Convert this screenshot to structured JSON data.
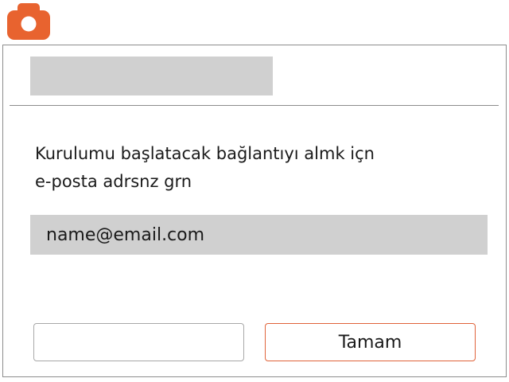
{
  "app": {
    "icon": "camera-icon",
    "accent_color": "#e8632f"
  },
  "dialog": {
    "title": "",
    "prompt_line1": "Kurulumu başlatacak bağlantıyı almk içn",
    "prompt_line2": "e-posta adrsnz grn",
    "email_input": {
      "value": "",
      "placeholder": "name@email.com"
    },
    "left_button_label": "",
    "ok_button_label": "Tamam",
    "ok_button_border_color": "#e0633a"
  }
}
